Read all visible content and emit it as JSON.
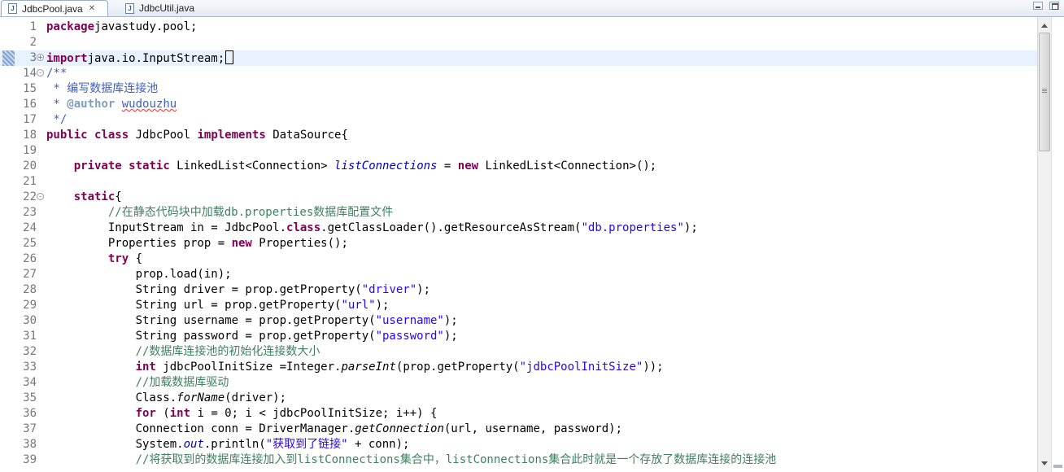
{
  "tabs": [
    {
      "label": "JdbcPool.java",
      "icon": "J",
      "active": true
    },
    {
      "label": "JdbcUtil.java",
      "icon": "J",
      "active": false
    }
  ],
  "lines": [
    {
      "n": "1",
      "fold": "",
      "tokens": [
        [
          "kw",
          "package"
        ],
        [
          "",
          "javastudy.pool;"
        ]
      ]
    },
    {
      "n": "2",
      "fold": "",
      "tokens": []
    },
    {
      "n": "3",
      "fold": "+",
      "current": true,
      "tokens": [
        [
          "kw",
          "import"
        ],
        [
          "",
          "java.io.InputStream;"
        ]
      ]
    },
    {
      "n": "14",
      "fold": "-",
      "tokens": [
        [
          "jd",
          "/**"
        ]
      ]
    },
    {
      "n": "15",
      "fold": "",
      "tokens": [
        [
          "jd",
          " * 编写数据库连接池"
        ]
      ]
    },
    {
      "n": "16",
      "fold": "",
      "tokens": [
        [
          "jd",
          " * "
        ],
        [
          "tag",
          "@author"
        ],
        [
          "jd",
          " "
        ],
        [
          "jdsq",
          "wudouzhu"
        ]
      ]
    },
    {
      "n": "17",
      "fold": "",
      "tokens": [
        [
          "jd",
          " */"
        ]
      ]
    },
    {
      "n": "18",
      "fold": "",
      "tokens": [
        [
          "kw",
          "public"
        ],
        [
          "",
          " "
        ],
        [
          "kw",
          "class"
        ],
        [
          "",
          " JdbcPool "
        ],
        [
          "kw",
          "implements"
        ],
        [
          "",
          " DataSource{"
        ]
      ]
    },
    {
      "n": "19",
      "fold": "",
      "tokens": []
    },
    {
      "n": "20",
      "fold": "",
      "tokens": [
        [
          "",
          "    "
        ],
        [
          "kw",
          "private"
        ],
        [
          "",
          " "
        ],
        [
          "kw",
          "static"
        ],
        [
          "",
          " LinkedList<Connection> "
        ],
        [
          "fld",
          "listConnections"
        ],
        [
          "",
          " = "
        ],
        [
          "kw",
          "new"
        ],
        [
          "",
          " LinkedList<Connection>();"
        ]
      ]
    },
    {
      "n": "21",
      "fold": "",
      "tokens": []
    },
    {
      "n": "22",
      "fold": "-",
      "tokens": [
        [
          "",
          "    "
        ],
        [
          "kw",
          "static"
        ],
        [
          "",
          "{"
        ]
      ]
    },
    {
      "n": "23",
      "fold": "",
      "tokens": [
        [
          "",
          "         "
        ],
        [
          "cm",
          "//在静态代码块中加载db.properties数据库配置文件"
        ]
      ]
    },
    {
      "n": "24",
      "fold": "",
      "tokens": [
        [
          "",
          "         InputStream in = JdbcPool."
        ],
        [
          "kw",
          "class"
        ],
        [
          "",
          ".getClassLoader().getResourceAsStream("
        ],
        [
          "str",
          "\"db.properties\""
        ],
        [
          "",
          ");"
        ]
      ]
    },
    {
      "n": "25",
      "fold": "",
      "tokens": [
        [
          "",
          "         Properties prop = "
        ],
        [
          "kw",
          "new"
        ],
        [
          "",
          " Properties();"
        ]
      ]
    },
    {
      "n": "26",
      "fold": "",
      "tokens": [
        [
          "",
          "         "
        ],
        [
          "kw",
          "try"
        ],
        [
          "",
          " {"
        ]
      ]
    },
    {
      "n": "27",
      "fold": "",
      "tokens": [
        [
          "",
          "             prop.load(in);"
        ]
      ]
    },
    {
      "n": "28",
      "fold": "",
      "tokens": [
        [
          "",
          "             String driver = prop.getProperty("
        ],
        [
          "str",
          "\"driver\""
        ],
        [
          "",
          ");"
        ]
      ]
    },
    {
      "n": "29",
      "fold": "",
      "tokens": [
        [
          "",
          "             String url = prop.getProperty("
        ],
        [
          "str",
          "\"url\""
        ],
        [
          "",
          ");"
        ]
      ]
    },
    {
      "n": "30",
      "fold": "",
      "tokens": [
        [
          "",
          "             String username = prop.getProperty("
        ],
        [
          "str",
          "\"username\""
        ],
        [
          "",
          ");"
        ]
      ]
    },
    {
      "n": "31",
      "fold": "",
      "tokens": [
        [
          "",
          "             String password = prop.getProperty("
        ],
        [
          "str",
          "\"password\""
        ],
        [
          "",
          ");"
        ]
      ]
    },
    {
      "n": "32",
      "fold": "",
      "tokens": [
        [
          "",
          "             "
        ],
        [
          "cm",
          "//数据库连接池的初始化连接数大小"
        ]
      ]
    },
    {
      "n": "33",
      "fold": "",
      "tokens": [
        [
          "",
          "             "
        ],
        [
          "kw",
          "int"
        ],
        [
          "",
          " jdbcPoolInitSize =Integer."
        ],
        [
          "it",
          "parseInt"
        ],
        [
          "",
          "(prop.getProperty("
        ],
        [
          "str",
          "\"jdbcPoolInitSize\""
        ],
        [
          "",
          "));"
        ]
      ]
    },
    {
      "n": "34",
      "fold": "",
      "tokens": [
        [
          "",
          "             "
        ],
        [
          "cm",
          "//加载数据库驱动"
        ]
      ]
    },
    {
      "n": "35",
      "fold": "",
      "tokens": [
        [
          "",
          "             Class."
        ],
        [
          "it",
          "forName"
        ],
        [
          "",
          "(driver);"
        ]
      ]
    },
    {
      "n": "36",
      "fold": "",
      "tokens": [
        [
          "",
          "             "
        ],
        [
          "kw",
          "for"
        ],
        [
          "",
          " ("
        ],
        [
          "kw",
          "int"
        ],
        [
          "",
          " i = 0; i < jdbcPoolInitSize; i++) {"
        ]
      ]
    },
    {
      "n": "37",
      "fold": "",
      "tokens": [
        [
          "",
          "             Connection conn = DriverManager."
        ],
        [
          "it",
          "getConnection"
        ],
        [
          "",
          "(url, username, password);"
        ]
      ]
    },
    {
      "n": "38",
      "fold": "",
      "tokens": [
        [
          "",
          "             System."
        ],
        [
          "fld",
          "out"
        ],
        [
          "",
          ".println("
        ],
        [
          "str",
          "\"获取到了链接\""
        ],
        [
          "",
          " + conn);"
        ]
      ]
    },
    {
      "n": "39",
      "fold": "",
      "tokens": [
        [
          "",
          "             "
        ],
        [
          "cm",
          "//将获取到的数据库连接加入到listConnections集合中，listConnections集合此时就是一个存放了数据库连接的连接池"
        ]
      ]
    }
  ]
}
